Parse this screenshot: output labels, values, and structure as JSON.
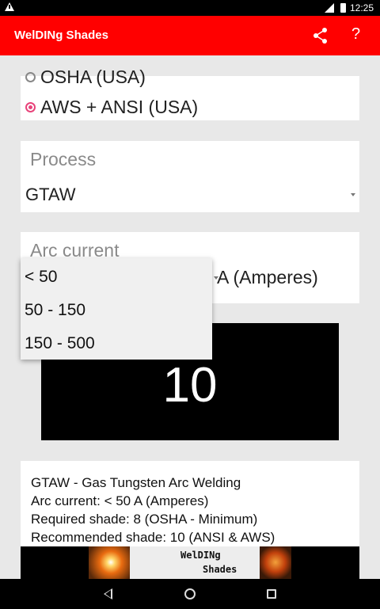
{
  "status_bar": {
    "time": "12:25",
    "icons": [
      "warning-icon",
      "signal-icon",
      "battery-icon"
    ]
  },
  "app_bar": {
    "title": "WelDINg Shades",
    "icons": [
      "share-icon"
    ],
    "help_label": "?"
  },
  "standard": {
    "options": [
      {
        "label": "OSHA (USA)",
        "selected": false
      },
      {
        "label": "AWS + ANSI (USA)",
        "selected": true
      }
    ]
  },
  "process": {
    "label": "Process",
    "value": "GTAW"
  },
  "arc_current": {
    "label": "Arc current",
    "unit": "A (Amperes)"
  },
  "dropdown": {
    "options": [
      "< 50",
      "50 - 150",
      "150 - 500"
    ]
  },
  "shade": {
    "value": "10"
  },
  "info": {
    "lines": [
      "GTAW - Gas Tungsten Arc Welding",
      "Arc current: < 50  A (Amperes)",
      "Required shade: 8 (OSHA - Minimum)",
      "Recommended shade: 10 (ANSI & AWS)"
    ]
  },
  "ad": {
    "line1": "WelDINg",
    "line2": "Shades"
  },
  "colors": {
    "app_bar": "#ff0000",
    "radio_accent": "#e8437a",
    "shade_box": "#000000"
  },
  "nav_bar": {
    "icons": [
      "back-icon",
      "home-icon",
      "recent-apps-icon"
    ]
  }
}
